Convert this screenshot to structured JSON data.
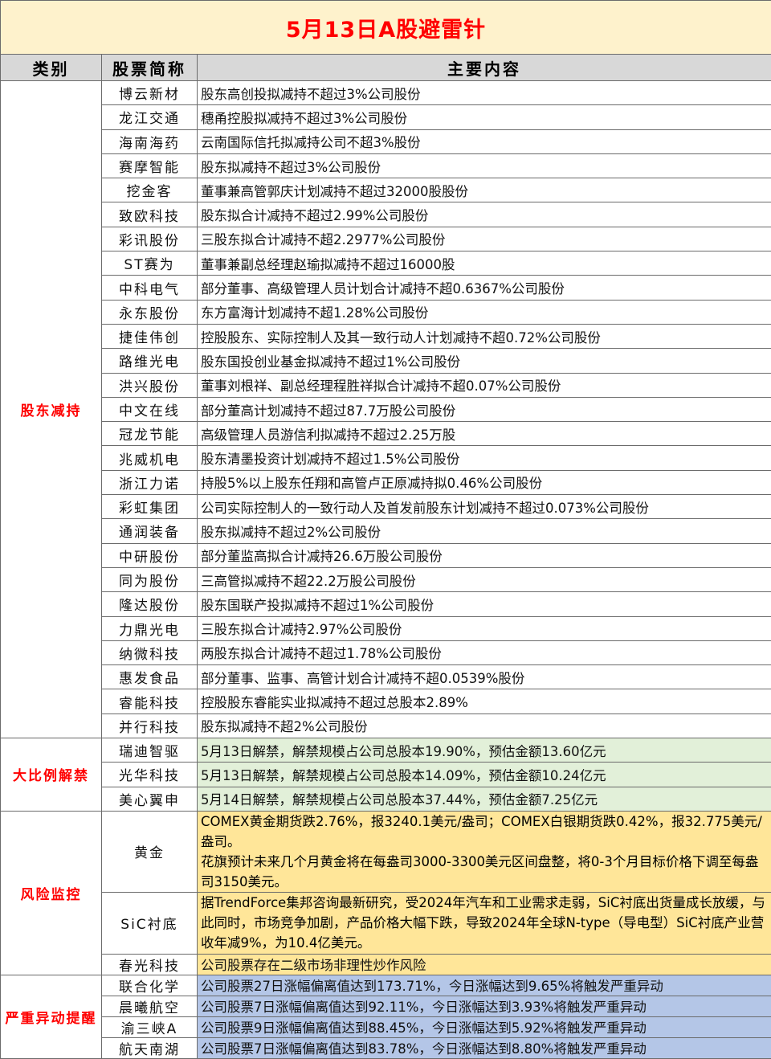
{
  "title": "5月13日A股避雷针",
  "headers": {
    "category": "类别",
    "name": "股票简称",
    "content": "主要内容"
  },
  "sections": [
    {
      "category": "股东减持",
      "rows": [
        {
          "name": "博云新材",
          "content": "股东高创投拟减持不超过3%公司股份"
        },
        {
          "name": "龙江交通",
          "content": "穗甬控股拟减持不超过3%公司股份"
        },
        {
          "name": "海南海药",
          "content": "云南国际信托拟减持公司不超3%股份"
        },
        {
          "name": "赛摩智能",
          "content": "股东拟减持不超过3%公司股份"
        },
        {
          "name": "挖金客",
          "content": "董事兼高管郭庆计划减持不超过32000股股份"
        },
        {
          "name": "致欧科技",
          "content": "股东拟合计减持不超过2.99%公司股份"
        },
        {
          "name": "彩讯股份",
          "content": "三股东拟合计减持不超2.2977%公司股份"
        },
        {
          "name": "ST赛为",
          "content": "董事兼副总经理赵瑜拟减持不超过16000股"
        },
        {
          "name": "中科电气",
          "content": "部分董事、高级管理人员计划合计减持不超0.6367%公司股份"
        },
        {
          "name": "永东股份",
          "content": "东方富海计划减持不超1.28%公司股份"
        },
        {
          "name": "捷佳伟创",
          "content": "控股股东、实际控制人及其一致行动人计划减持不超0.72%公司股份"
        },
        {
          "name": "路维光电",
          "content": "股东国投创业基金拟减持不超过1%公司股份"
        },
        {
          "name": "洪兴股份",
          "content": "董事刘根祥、副总经理程胜祥拟合计减持不超0.07%公司股份"
        },
        {
          "name": "中文在线",
          "content": "部分董高计划减持不超过87.7万股公司股份"
        },
        {
          "name": "冠龙节能",
          "content": "高级管理人员游信利拟减持不超过2.25万股"
        },
        {
          "name": "兆威机电",
          "content": "股东清墨投资计划减持不超过1.5%公司股份"
        },
        {
          "name": "浙江力诺",
          "content": "持股5%以上股东任翔和高管卢正原减持拟0.46%公司股份"
        },
        {
          "name": "彩虹集团",
          "content": "公司实际控制人的一致行动人及首发前股东计划减持不超过0.073%公司股份"
        },
        {
          "name": "通润装备",
          "content": "股东拟减持不超过2%公司股份"
        },
        {
          "name": "中研股份",
          "content": "部分董监高拟合计减持26.6万股公司股份"
        },
        {
          "name": "同为股份",
          "content": "三高管拟减持不超22.2万股公司股份"
        },
        {
          "name": "隆达股份",
          "content": "股东国联产投拟减持不超过1%公司股份"
        },
        {
          "name": "力鼎光电",
          "content": "三股东拟合计减持2.97%公司股份"
        },
        {
          "name": "纳微科技",
          "content": "两股东拟合计减持不超过1.78%公司股份"
        },
        {
          "name": "惠发食品",
          "content": "部分董事、监事、高管计划合计减持不超0.0539%股份"
        },
        {
          "name": "睿能科技",
          "content": "控股股东睿能实业拟减持不超过总股本2.89%"
        },
        {
          "name": "并行科技",
          "content": "股东拟减持不超2%公司股份"
        }
      ]
    },
    {
      "category": "大比例解禁",
      "rows": [
        {
          "name": "瑞迪智驱",
          "content": "5月13日解禁，解禁规模占公司总股本19.90%，预估金额13.60亿元"
        },
        {
          "name": "光华科技",
          "content": "5月13日解禁，解禁规模占公司总股本14.09%，预估金额10.24亿元"
        },
        {
          "name": "美心翼申",
          "content": "5月14日解禁，解禁规模占公司总股本37.44%，预估金额7.25亿元"
        }
      ]
    },
    {
      "category": "风险监控",
      "rows": [
        {
          "name": "黄金",
          "content": "COMEX黄金期货跌2.76%，报3240.1美元/盎司；COMEX白银期货跌0.42%，报32.775美元/盎司。",
          "content2": "花旗预计未来几个月黄金将在每盎司3000-3300美元区间盘整，将0-3个月目标价格下调至每盎司3150美元。"
        },
        {
          "name": "SiC衬底",
          "content": "据TrendForce集邦咨询最新研究，受2024年汽车和工业需求走弱，SiC衬底出货量成长放缓，与此同时，市场竞争加剧，产品价格大幅下跌，导致2024年全球N-type（导电型）SiC衬底产业营收年减9%，为10.4亿美元。"
        },
        {
          "name": "春光科技",
          "content": "公司股票存在二级市场非理性炒作风险"
        }
      ]
    },
    {
      "category": "严重异动提醒",
      "rows": [
        {
          "name": "联合化学",
          "content": "公司股票27日涨幅偏离值达到173.71%，今日涨幅达到9.65%将触发严重异动"
        },
        {
          "name": "晨曦航空",
          "content": "公司股票7日涨幅偏离值达到92.11%，今日涨幅达到3.93%将触发严重异动"
        },
        {
          "name": "渝三峡A",
          "content": "公司股票9日涨幅偏离值达到88.45%，今日涨幅达到5.92%将触发严重异动"
        },
        {
          "name": "航天南湖",
          "content": "公司股票7日涨幅偏离值达到83.78%，今日涨幅达到8.80%将触发严重异动"
        }
      ]
    }
  ],
  "colors": {
    "title_bg": "#fef2cc",
    "title_text": "#ff0000",
    "header_bg": "#d8d8d8",
    "unlock_bg": "#e2f0d9",
    "risk_bg": "#ffe699",
    "alert_bg": "#b4c6e7"
  }
}
